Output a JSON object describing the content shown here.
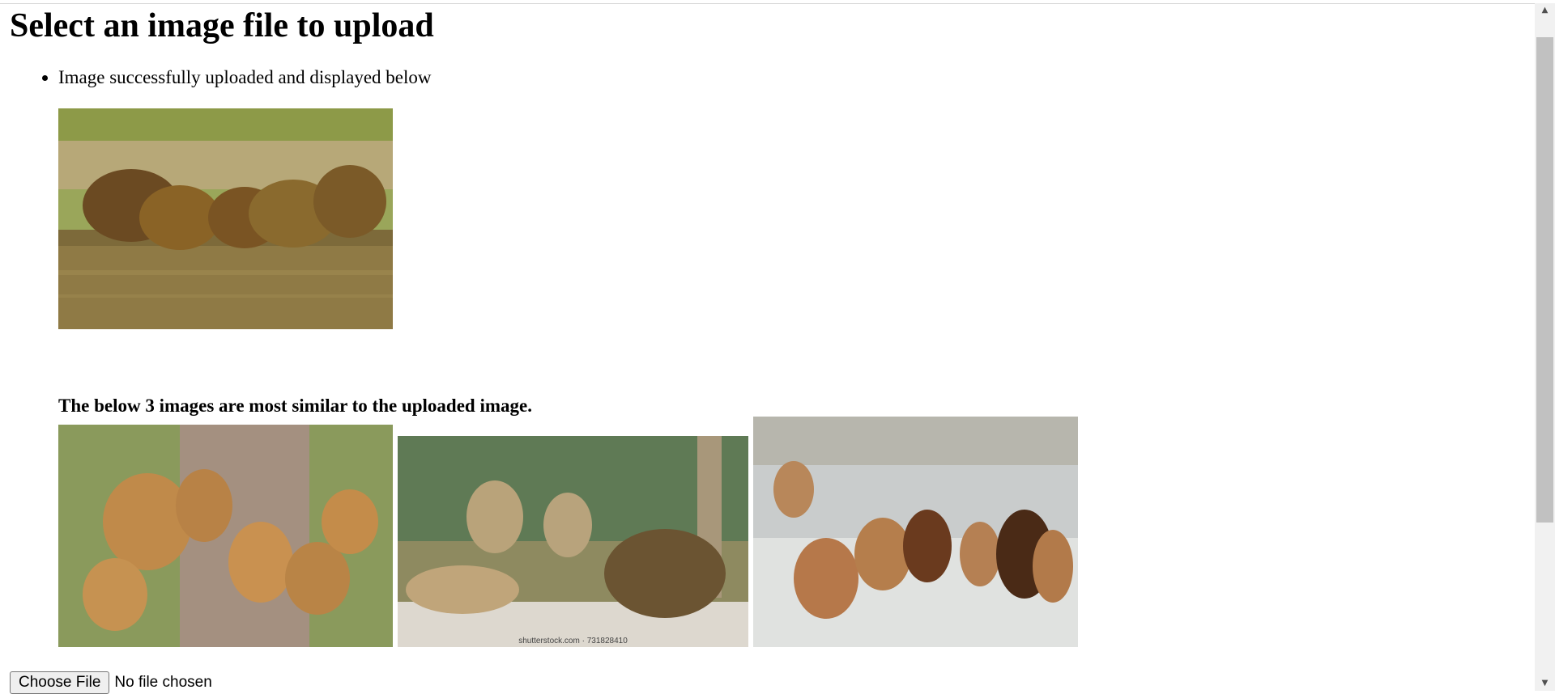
{
  "page": {
    "title": "Select an image file to upload",
    "status_message": "Image successfully uploaded and displayed below",
    "similar_caption": "The below 3 images are most similar to the uploaded image.",
    "choose_file_label": "Choose File",
    "file_status": "No file chosen"
  },
  "images": {
    "uploaded": "uploaded-lions-drinking",
    "similar_1": "lionesses-and-cubs-walking",
    "similar_2": "lion-pride-resting",
    "similar_3": "lions-walking-in-snow"
  },
  "watermark": "shutterstock.com · 731828410"
}
